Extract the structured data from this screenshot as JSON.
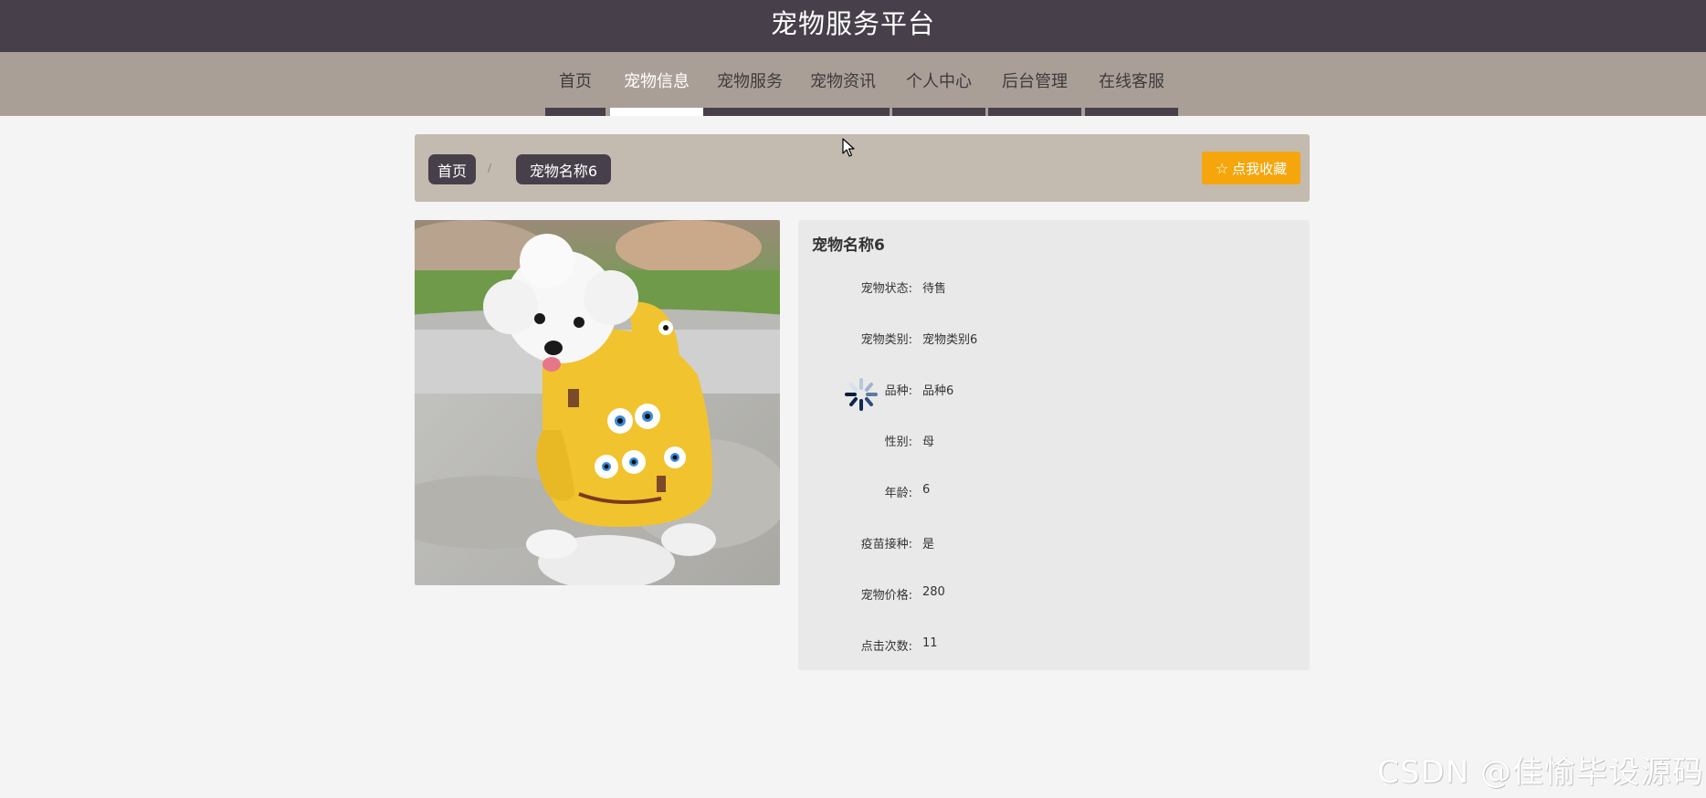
{
  "header": {
    "title": "宠物服务平台"
  },
  "nav": {
    "items": [
      {
        "label": "首页",
        "active": false
      },
      {
        "label": "宠物信息",
        "active": true
      },
      {
        "label": "宠物服务",
        "active": false
      },
      {
        "label": "宠物资讯",
        "active": false
      },
      {
        "label": "个人中心",
        "active": false
      },
      {
        "label": "后台管理",
        "active": false
      },
      {
        "label": "在线客服",
        "active": false
      }
    ]
  },
  "breadcrumb": {
    "home": "首页",
    "separator": "/",
    "current": "宠物名称6"
  },
  "favorite_button": {
    "icon": "star-outline-icon",
    "label": "点我收藏"
  },
  "pet": {
    "name": "宠物名称6",
    "photo_description": "white poodle in yellow SpongeBob hoodie",
    "fields": [
      {
        "label": "宠物状态:",
        "value": "待售"
      },
      {
        "label": "宠物类别:",
        "value": "宠物类别6"
      },
      {
        "label": "品种:",
        "value": "品种6"
      },
      {
        "label": "性别:",
        "value": "母"
      },
      {
        "label": "年龄:",
        "value": "6"
      },
      {
        "label": "疫苗接种:",
        "value": "是"
      },
      {
        "label": "宠物价格:",
        "value": "280"
      },
      {
        "label": "点击次数:",
        "value": "11"
      }
    ]
  },
  "watermark": "CSDN @佳愉毕设源码",
  "colors": {
    "header_bg": "#47404b",
    "nav_bg": "#aa9f97",
    "crumb_bg": "#c4bbb0",
    "accent": "#f5a60c",
    "panel_bg": "#e9e9e9"
  }
}
